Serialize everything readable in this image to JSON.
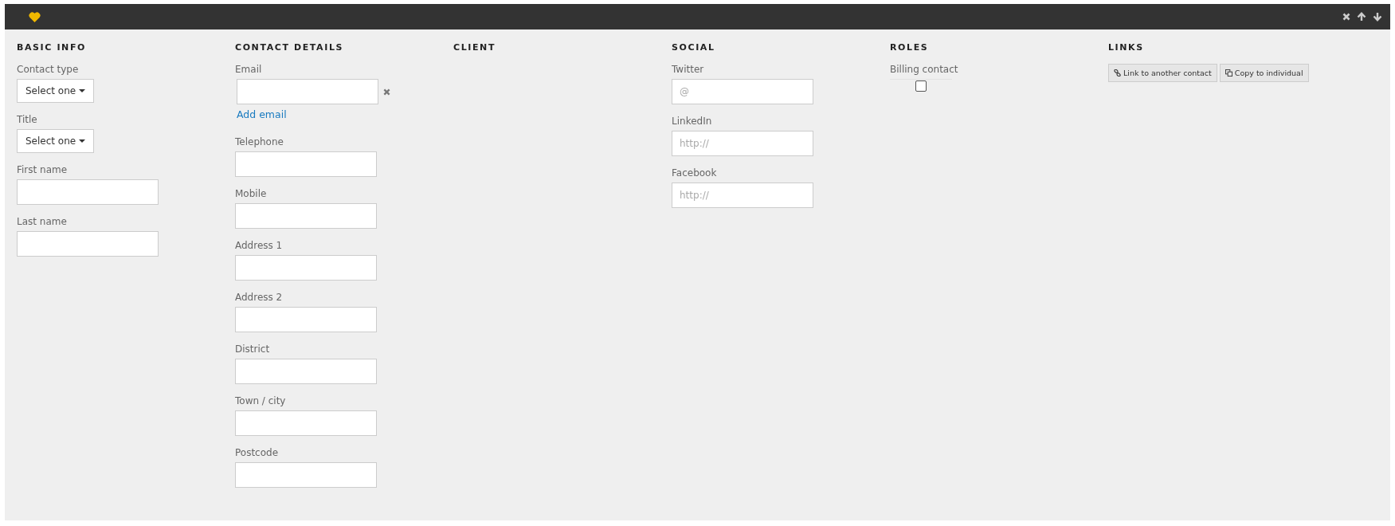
{
  "sections": [
    {
      "title": "BASIC INFO",
      "fields": [
        {
          "kind": "select",
          "label": "Contact type",
          "value": "Select one"
        },
        {
          "kind": "select",
          "label": "Title",
          "value": "Select one"
        },
        {
          "kind": "input",
          "label": "First name"
        },
        {
          "kind": "input",
          "label": "Last name"
        }
      ]
    },
    {
      "title": "CONTACT DETAILS",
      "fields": [
        {
          "kind": "removable",
          "label": "Email",
          "link": "Add email"
        },
        {
          "kind": "input",
          "label": "Telephone"
        },
        {
          "kind": "input",
          "label": "Mobile"
        },
        {
          "kind": "input",
          "label": "Address 1"
        },
        {
          "kind": "input",
          "label": "Address 2"
        },
        {
          "kind": "input",
          "label": "District"
        },
        {
          "kind": "input",
          "label": "Town / city"
        },
        {
          "kind": "input",
          "label": "Postcode"
        }
      ]
    },
    {
      "title": "CLIENT"
    },
    {
      "title": "SOCIAL",
      "fields": [
        {
          "kind": "input",
          "label": "Twitter",
          "placeholder": "@"
        },
        {
          "kind": "input",
          "label": "LinkedIn",
          "placeholder": "http://"
        },
        {
          "kind": "input",
          "label": "Facebook",
          "placeholder": "http://"
        }
      ]
    },
    {
      "title": "ROLES",
      "fields": [
        {
          "kind": "checkbox",
          "label": "Billing contact",
          "checked": false
        }
      ]
    },
    {
      "title": "LINKS",
      "fields": [
        {
          "kind": "buttons",
          "buttons": [
            {
              "kind": "link",
              "label": "Link to another contact"
            },
            {
              "kind": "copy",
              "label": "Copy to individual"
            }
          ]
        }
      ]
    }
  ]
}
